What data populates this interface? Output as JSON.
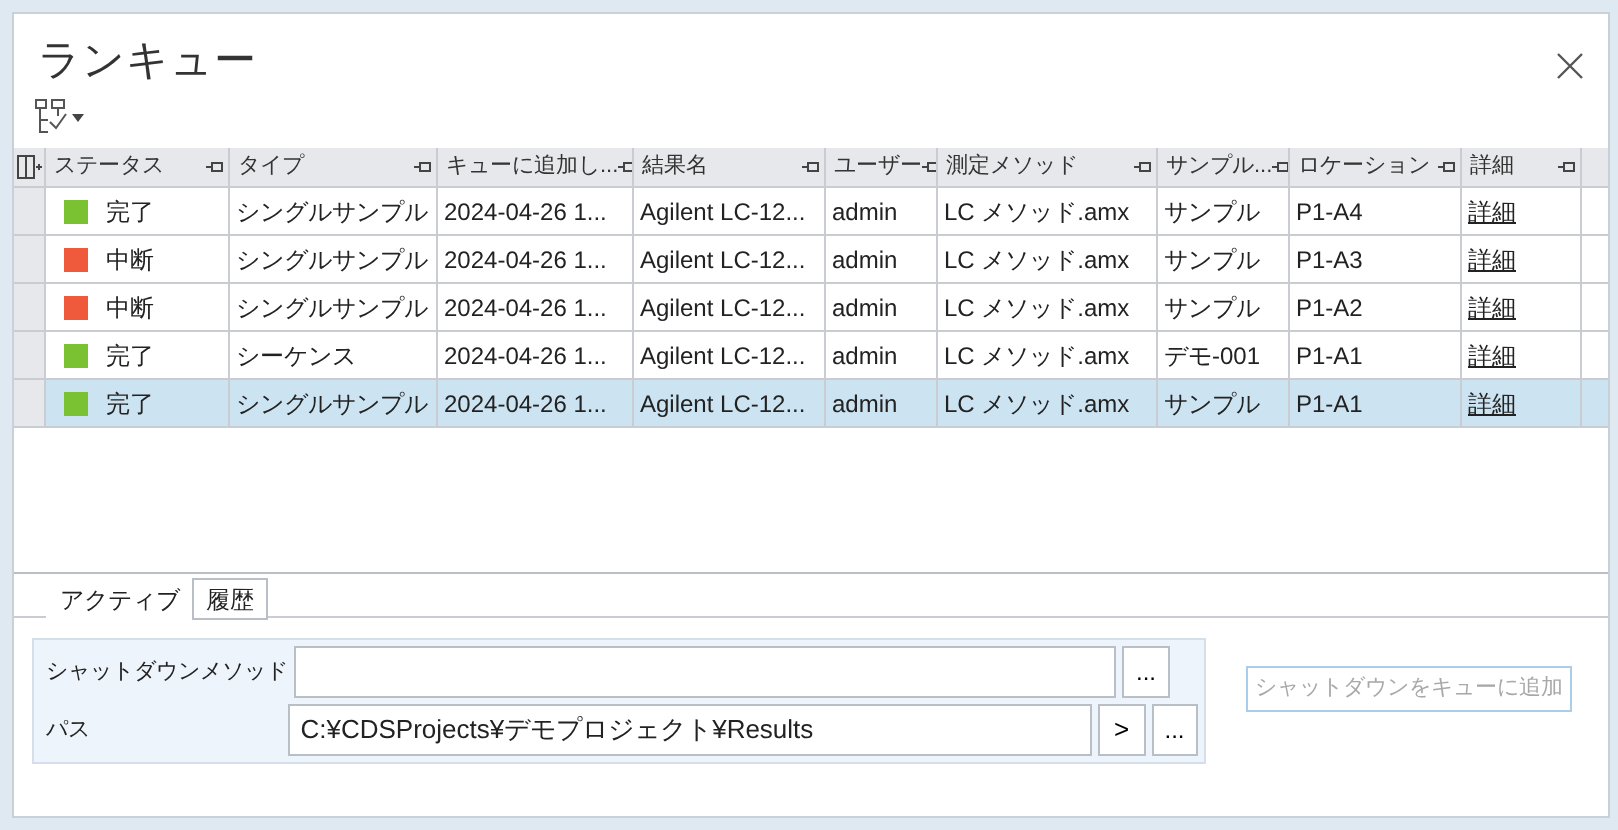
{
  "window": {
    "title": "ランキュー"
  },
  "table": {
    "columns": [
      "ステータス",
      "タイプ",
      "キューに追加し...",
      "結果名",
      "ユーザー",
      "測定メソッド",
      "サンプル...",
      "ロケーション",
      "詳細"
    ],
    "rows": [
      {
        "selected": false,
        "status": "完了",
        "color": "#7ac231",
        "type": "シングルサンプル",
        "added": "2024-04-26 1...",
        "result": "Agilent LC-12...",
        "user": "admin",
        "method": "LC メソッド.amx",
        "sample": "サンプル",
        "location": "P1-A4",
        "detail": "詳細"
      },
      {
        "selected": false,
        "status": "中断",
        "color": "#f05a3c",
        "type": "シングルサンプル",
        "added": "2024-04-26 1...",
        "result": "Agilent LC-12...",
        "user": "admin",
        "method": "LC メソッド.amx",
        "sample": "サンプル",
        "location": "P1-A3",
        "detail": "詳細"
      },
      {
        "selected": false,
        "status": "中断",
        "color": "#f05a3c",
        "type": "シングルサンプル",
        "added": "2024-04-26 1...",
        "result": "Agilent LC-12...",
        "user": "admin",
        "method": "LC メソッド.amx",
        "sample": "サンプル",
        "location": "P1-A2",
        "detail": "詳細"
      },
      {
        "selected": false,
        "status": "完了",
        "color": "#7ac231",
        "type": "シーケンス",
        "added": "2024-04-26 1...",
        "result": "Agilent LC-12...",
        "user": "admin",
        "method": "LC メソッド.amx",
        "sample": "デモ-001",
        "location": "P1-A1",
        "detail": "詳細"
      },
      {
        "selected": true,
        "status": "完了",
        "color": "#7ac231",
        "type": "シングルサンプル",
        "added": "2024-04-26 1...",
        "result": "Agilent LC-12...",
        "user": "admin",
        "method": "LC メソッド.amx",
        "sample": "サンプル",
        "location": "P1-A1",
        "detail": "詳細"
      }
    ]
  },
  "tabs": [
    {
      "label": "アクティブ",
      "selected": true
    },
    {
      "label": "履歴",
      "selected": false
    }
  ],
  "form": {
    "shutdown_method": {
      "label": "シャットダウンメソッド",
      "browse": "..."
    },
    "path": {
      "label": "パス",
      "value": "C:¥CDSProjects¥デモプロジェクト¥Results",
      "go": ">",
      "browse": "..."
    }
  },
  "add_button": {
    "label": "シャットダウンをキューに追加",
    "disabled": true
  }
}
